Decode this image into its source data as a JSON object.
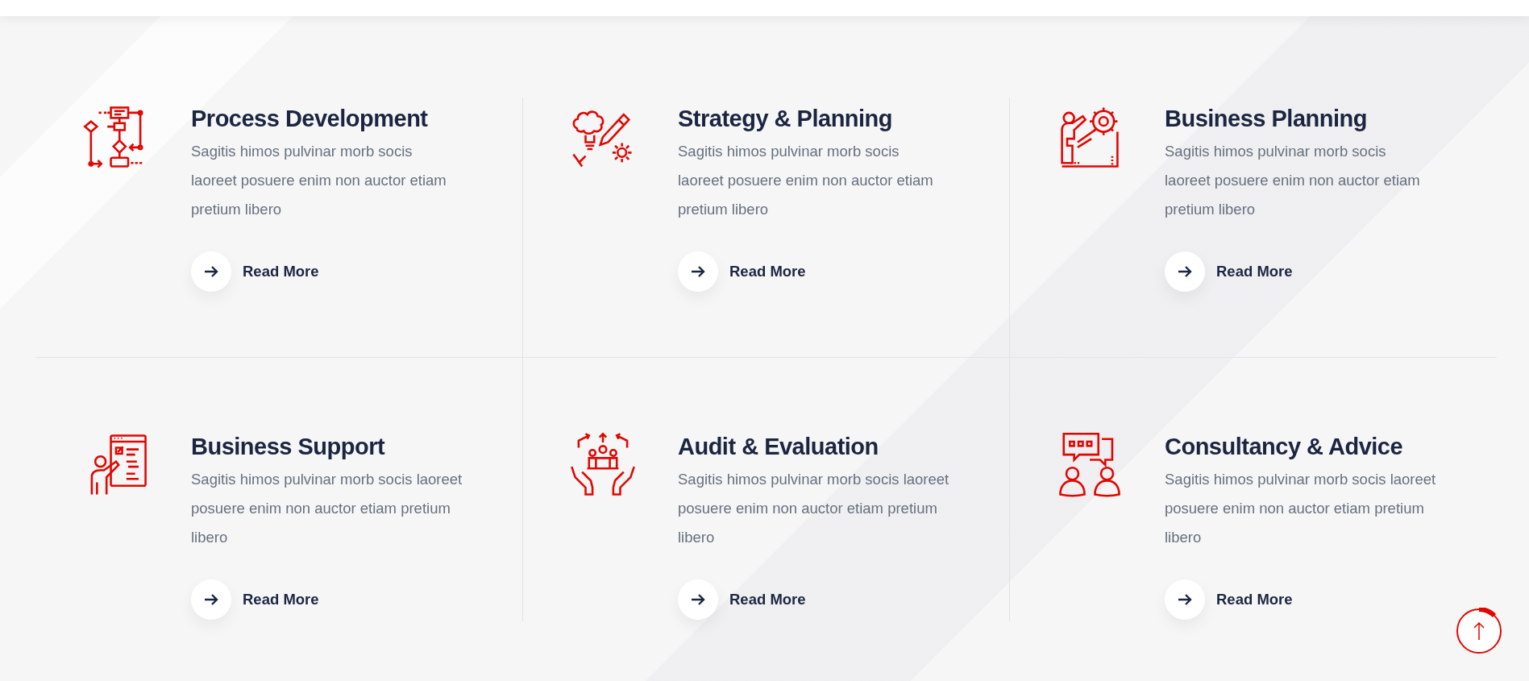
{
  "services": [
    {
      "title": "Process Development",
      "description": "Sagitis himos pulvinar morb socis laoreet posuere enim non auctor etiam pretium libero",
      "link": "Read More"
    },
    {
      "title": "Strategy & Planning",
      "description": "Sagitis himos pulvinar morb socis laoreet posuere enim non auctor etiam pretium libero",
      "link": "Read More"
    },
    {
      "title": "Business Planning",
      "description": "Sagitis himos pulvinar morb socis laoreet posuere enim non auctor etiam pretium libero",
      "link": "Read More"
    },
    {
      "title": "Business Support",
      "description": "Sagitis himos pulvinar morb socis laoreet posuere enim non auctor etiam pretium libero",
      "link": "Read More"
    },
    {
      "title": "Audit & Evaluation",
      "description": "Sagitis himos pulvinar morb socis laoreet posuere enim non auctor etiam pretium libero",
      "link": "Read More"
    },
    {
      "title": "Consultancy & Advice",
      "description": "Sagitis himos pulvinar morb socis laoreet posuere enim non auctor etiam pretium libero",
      "link": "Read More"
    }
  ]
}
